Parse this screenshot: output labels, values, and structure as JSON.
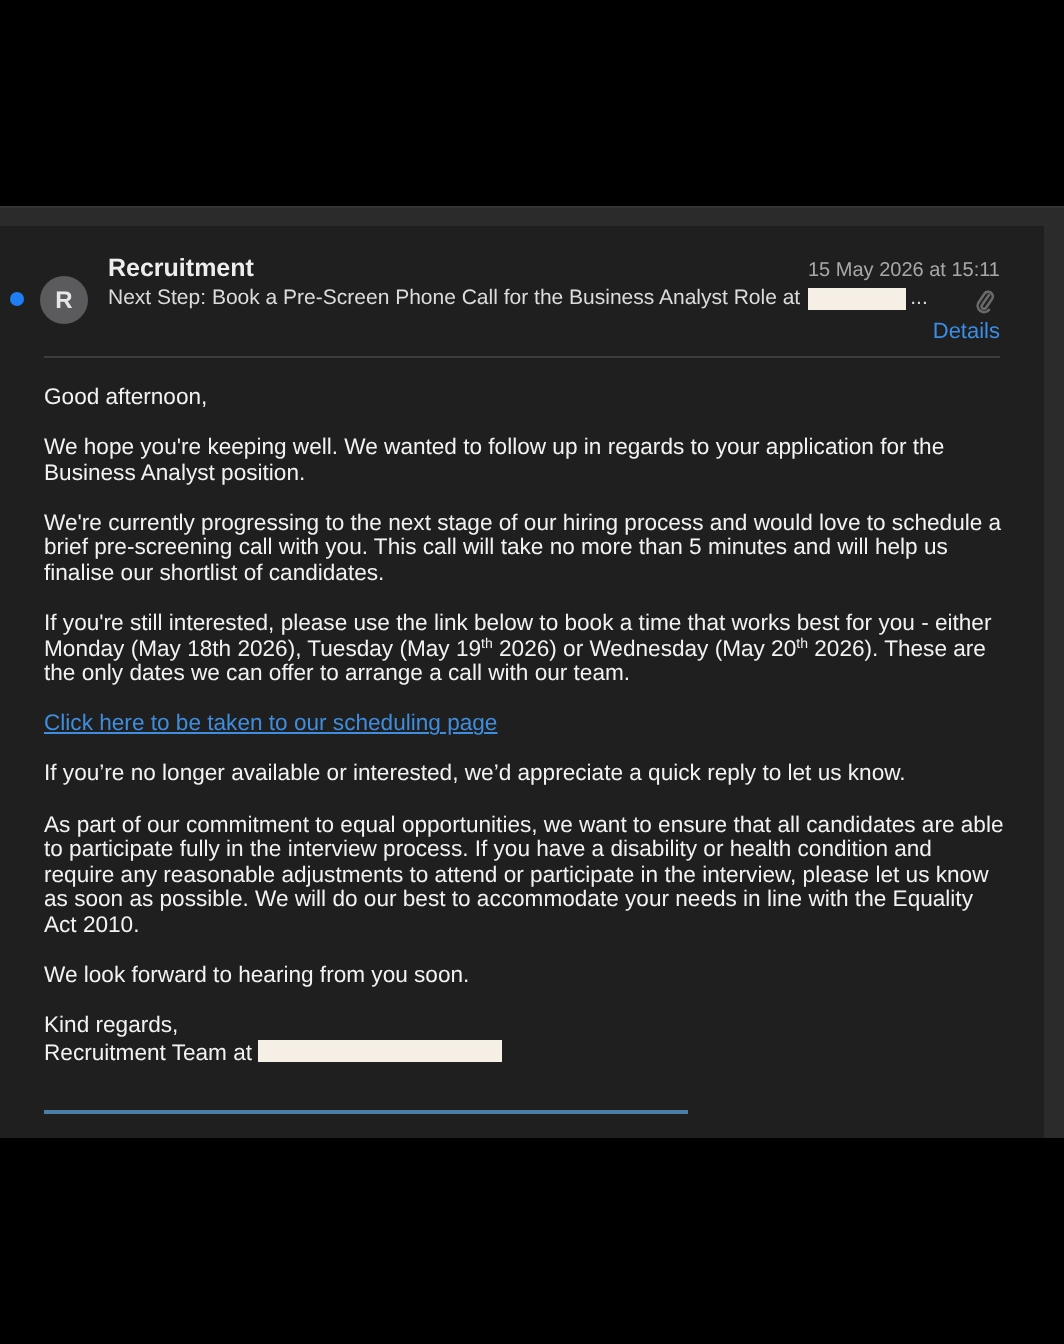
{
  "message": {
    "unread": true,
    "avatar_initial": "R",
    "sender": "Recruitment",
    "date": "15 May 2026 at 15:11",
    "subject": "Next Step: Book a Pre-Screen Phone Call for the Business Analyst Role at",
    "subject_ellipsis": "...",
    "subject_redacted": true,
    "has_attachment": true,
    "details_link": "Details"
  },
  "body": [
    {
      "kind": "text",
      "text": "Good afternoon,"
    },
    {
      "kind": "text",
      "text": "We hope you're keeping well. We wanted to follow up in regards to your application for the Business Analyst position."
    },
    {
      "kind": "text",
      "text": "We're currently progressing to the next stage of our hiring process and would love to schedule a brief pre-screening call with you. This call will take no more than 5 minutes and will help us finalise our shortlist of candidates."
    },
    {
      "kind": "text",
      "text": "If you're still interested, please use the link below to book a time that works best for you - either Monday (May 18th 2026), Tuesday (May 19$^{th}$ 2026) or Wednesday (May 20$^{th}$ 2026). These are the only dates we can offer to arrange a call with our team."
    },
    {
      "kind": "link",
      "text": "Click here to be taken to our scheduling page"
    },
    {
      "kind": "text",
      "text": "If you’re no longer available or interested, we’d appreciate a quick reply to let us know."
    },
    {
      "kind": "text",
      "text": "As part of our commitment to equal opportunities, we want to ensure that all candidates are able to participate fully in the interview process. If you have a disability or health condition and require any reasonable adjustments to attend or participate in the interview, please let us know as soon as possible. We will do our best to accommodate your needs in line with the Equality Act 2010."
    },
    {
      "kind": "text",
      "text": "We look forward to hearing from you soon."
    },
    {
      "kind": "signature",
      "lines": [
        "Kind regards,",
        "Recruitment Team at"
      ],
      "redacted": true
    }
  ]
}
